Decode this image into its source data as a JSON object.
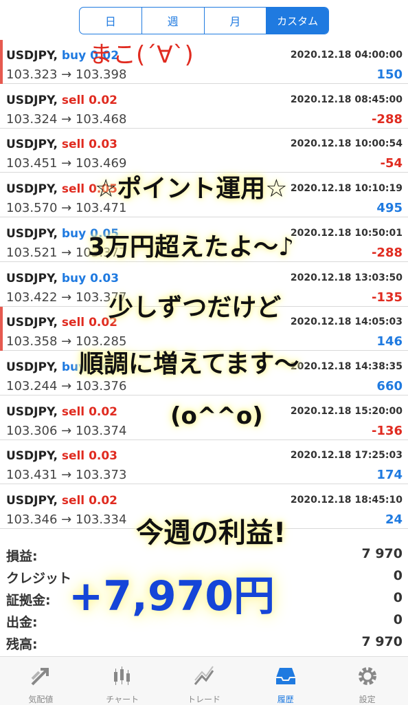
{
  "tabs": [
    "日",
    "週",
    "月",
    "カスタム"
  ],
  "trades": [
    {
      "symbol": "USDJPY,",
      "side": "buy",
      "lot": "0.02",
      "time": "2020.12.18 04:00:00",
      "open": "103.323",
      "close": "103.398",
      "profit": "150",
      "pos": true,
      "mark": true
    },
    {
      "symbol": "USDJPY,",
      "side": "sell",
      "lot": "0.02",
      "time": "2020.12.18 08:45:00",
      "open": "103.324",
      "close": "103.468",
      "profit": "-288",
      "pos": false,
      "mark": false
    },
    {
      "symbol": "USDJPY,",
      "side": "sell",
      "lot": "0.03",
      "time": "2020.12.18 10:00:54",
      "open": "103.451",
      "close": "103.469",
      "profit": "-54",
      "pos": false,
      "mark": false
    },
    {
      "symbol": "USDJPY,",
      "side": "sell",
      "lot": "0.05",
      "time": "2020.12.18 10:10:19",
      "open": "103.570",
      "close": "103.471",
      "profit": "495",
      "pos": true,
      "mark": false
    },
    {
      "symbol": "USDJPY,",
      "side": "buy",
      "lot": "0.05",
      "time": "2020.12.18 10:50:01",
      "open": "103.521",
      "close": "103.377",
      "profit": "-288",
      "pos": false,
      "mark": false
    },
    {
      "symbol": "USDJPY,",
      "side": "buy",
      "lot": "0.03",
      "time": "2020.12.18 13:03:50",
      "open": "103.422",
      "close": "103.377",
      "profit": "-135",
      "pos": false,
      "mark": false
    },
    {
      "symbol": "USDJPY,",
      "side": "sell",
      "lot": "0.02",
      "time": "2020.12.18 14:05:03",
      "open": "103.358",
      "close": "103.285",
      "profit": "146",
      "pos": true,
      "mark": true
    },
    {
      "symbol": "USDJPY,",
      "side": "buy",
      "lot": "0.05",
      "time": "2020.12.18 14:38:35",
      "open": "103.244",
      "close": "103.376",
      "profit": "660",
      "pos": true,
      "mark": false
    },
    {
      "symbol": "USDJPY,",
      "side": "sell",
      "lot": "0.02",
      "time": "2020.12.18 15:20:00",
      "open": "103.306",
      "close": "103.374",
      "profit": "-136",
      "pos": false,
      "mark": false
    },
    {
      "symbol": "USDJPY,",
      "side": "sell",
      "lot": "0.03",
      "time": "2020.12.18 17:25:03",
      "open": "103.431",
      "close": "103.373",
      "profit": "174",
      "pos": true,
      "mark": false
    },
    {
      "symbol": "USDJPY,",
      "side": "sell",
      "lot": "0.02",
      "time": "2020.12.18 18:45:10",
      "open": "103.346",
      "close": "103.334",
      "profit": "24",
      "pos": true,
      "mark": false
    }
  ],
  "summary": [
    {
      "label": "損益:",
      "value": "7 970"
    },
    {
      "label": "クレジット",
      "value": "0"
    },
    {
      "label": "証拠金:",
      "value": "0"
    },
    {
      "label": "出金:",
      "value": "0"
    },
    {
      "label": "残高:",
      "value": "7 970"
    }
  ],
  "bottom_tabs": [
    {
      "label": "気配値",
      "icon": "quotes-icon",
      "active": false
    },
    {
      "label": "チャート",
      "icon": "chart-icon",
      "active": false
    },
    {
      "label": "トレード",
      "icon": "trade-icon",
      "active": false
    },
    {
      "label": "履歴",
      "icon": "history-icon",
      "active": true
    },
    {
      "label": "設定",
      "icon": "gear-icon",
      "active": false
    }
  ],
  "overlay_text": {
    "top": "まこ(´∀`)",
    "l1": "☆ポイント運用☆",
    "l2": "3万円超えたよ〜♪",
    "l3": "少しずつだけど",
    "l4": "順調に増えてます〜",
    "l5": "(o^^o)",
    "l6": "今週の利益!",
    "big": "+7,970円"
  },
  "colors": {
    "accent": "#1f7ae0",
    "negative": "#e02b20",
    "highlight": "#fff8a8",
    "big_text": "#1545d8"
  }
}
